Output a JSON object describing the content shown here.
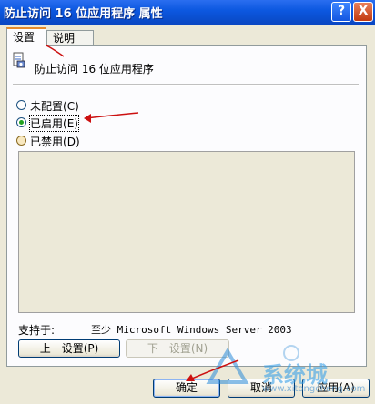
{
  "window": {
    "title": "防止访问 16 位应用程序 属性",
    "help_glyph": "?",
    "close_glyph": "X"
  },
  "tabs": [
    {
      "label": "设置",
      "active": true
    },
    {
      "label": "说明",
      "active": false
    }
  ],
  "policy": {
    "name": "防止访问 16 位应用程序",
    "icon": "policy-setting-icon"
  },
  "options": [
    {
      "label": "未配置",
      "key": "(C)",
      "checked": false
    },
    {
      "label": "已启用",
      "key": "(E)",
      "checked": true
    },
    {
      "label": "已禁用",
      "key": "(D)",
      "checked": false
    }
  ],
  "supported": {
    "label": "支持于:",
    "value": "至少 Microsoft Windows Server 2003"
  },
  "buttons": {
    "prev": "上一设置(P)",
    "next": "下一设置(N)",
    "ok": "确定",
    "cancel": "取消",
    "apply": "应用(A)"
  },
  "watermark": {
    "brand": "系统城",
    "url": "www.xitongcheng.com"
  },
  "colors": {
    "titlebar": "#0a4fd0",
    "annotation_arrow": "#cc1010",
    "radio_check": "#21a121"
  }
}
